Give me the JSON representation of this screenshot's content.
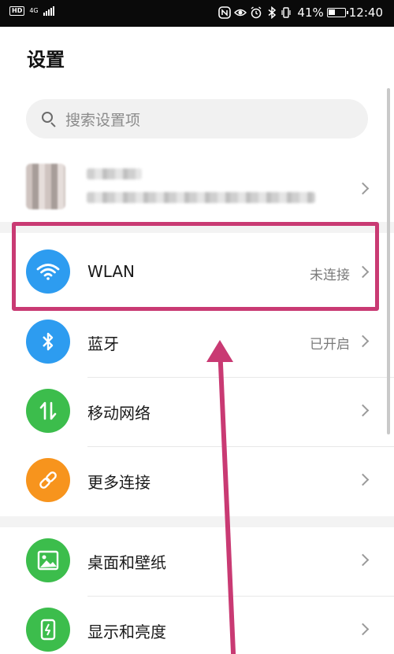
{
  "status_bar": {
    "hd": "HD",
    "network_type": "4G",
    "battery_percent": "41%",
    "battery_level": 0.41,
    "time": "12:40",
    "icons": [
      "nfc-icon",
      "eye-icon",
      "alarm-icon",
      "bluetooth-icon",
      "vibrate-icon"
    ]
  },
  "page": {
    "title": "设置"
  },
  "search": {
    "placeholder": "搜索设置项"
  },
  "account": {
    "name_blurred": true
  },
  "rows": [
    {
      "key": "wlan",
      "label": "WLAN",
      "value": "未连接",
      "icon": "wifi-icon",
      "color": "#2d9cf0"
    },
    {
      "key": "bluetooth",
      "label": "蓝牙",
      "value": "已开启",
      "icon": "bluetooth-icon",
      "color": "#2d9cf0"
    },
    {
      "key": "mobile-network",
      "label": "移动网络",
      "value": "",
      "icon": "data-transfer-icon",
      "color": "#3cbd4c"
    },
    {
      "key": "more-connections",
      "label": "更多连接",
      "value": "",
      "icon": "link-icon",
      "color": "#f7941d"
    },
    {
      "key": "home-wallpaper",
      "label": "桌面和壁纸",
      "value": "",
      "icon": "image-icon",
      "color": "#3cbd4c"
    },
    {
      "key": "display-brightness",
      "label": "显示和亮度",
      "value": "",
      "icon": "phone-display-icon",
      "color": "#3cbd4c"
    }
  ],
  "annotation": {
    "color": "#c93a73",
    "target": "wlan"
  }
}
